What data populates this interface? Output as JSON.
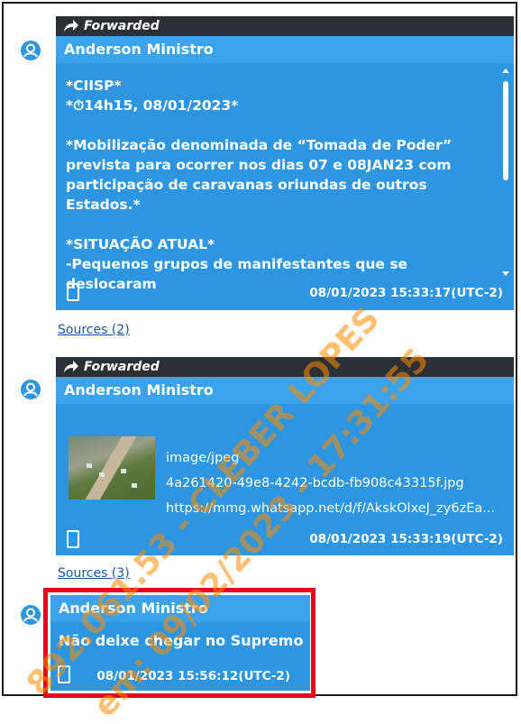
{
  "messages": [
    {
      "forward_label": "Forwarded",
      "sender": "Anderson Ministro",
      "text": "*CIISP*\n*⏱14h15, 08/01/2023*\n\n*Mobilização denominada de “Tomada de Poder” prevista para ocorrer nos dias 07 e 08JAN23 com participação de caravanas oriundas de outros Estados.*\n\n*SITUAÇÃO ATUAL*\n-Pequenos grupos de manifestantes que se deslocaram",
      "timestamp": "08/01/2023 15:33:17(UTC-2)",
      "sources": "Sources (2)"
    },
    {
      "forward_label": "Forwarded",
      "sender": "Anderson Ministro",
      "attachment": {
        "type": "image/jpeg",
        "filename": "4a261420-49e8-4242-bcdb-fb908c43315f.jpg",
        "url": "https://mmg.whatsapp.net/d/f/AkskOlxeJ_zy6zEa..."
      },
      "timestamp": "08/01/2023 15:33:19(UTC-2)",
      "sources": "Sources (3)"
    },
    {
      "sender": "Anderson Ministro",
      "text": "Não deixe chegar no Supremo",
      "timestamp": "08/01/2023 15:56:12(UTC-2)"
    }
  ],
  "watermark": {
    "line1": "892.061.53 - CLEBER LOPES",
    "line2": "em: 09/02/2023 - 17:31:55"
  },
  "colors": {
    "bubble": "#2e96e0",
    "sender_bar": "#3aa3ec",
    "forward_bar": "#2b3036",
    "highlight": "#e8001c",
    "link": "#1a55a8"
  },
  "icons": {
    "forward": "forward-arrow-icon",
    "avatar": "user-avatar-icon",
    "device": "phone-icon",
    "clock": "stopwatch-icon"
  }
}
